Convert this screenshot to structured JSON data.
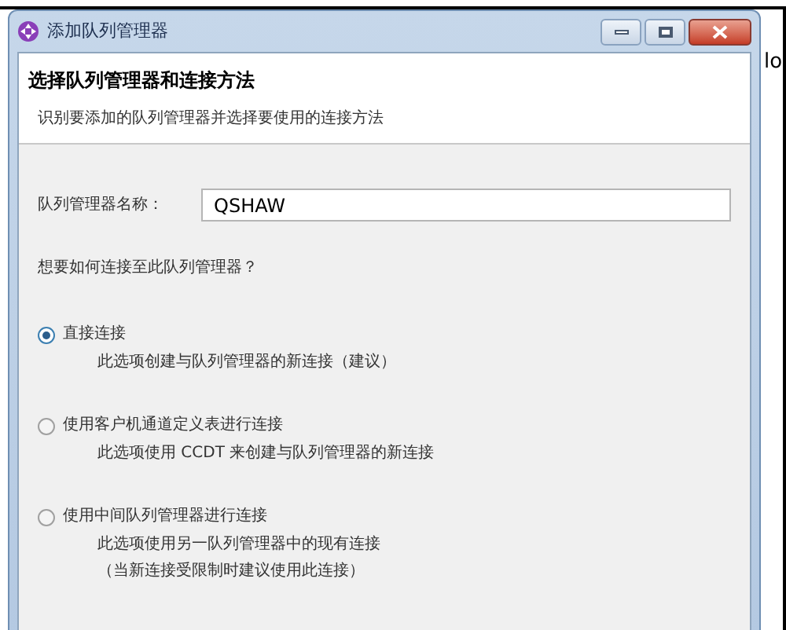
{
  "window": {
    "title": "添加队列管理器"
  },
  "background_text": "lo",
  "header": {
    "title": "选择队列管理器和连接方法",
    "subtitle": "识别要添加的队列管理器并选择要使用的连接方法"
  },
  "name_field": {
    "label": "队列管理器名称：",
    "value": "QSHAW"
  },
  "question": "想要如何连接至此队列管理器？",
  "options": [
    {
      "label": "直接连接",
      "selected": true,
      "description": [
        "此选项创建与队列管理器的新连接（建议）"
      ]
    },
    {
      "label": "使用客户机通道定义表进行连接",
      "selected": false,
      "description": [
        "此选项使用 CCDT 来创建与队列管理器的新连接"
      ]
    },
    {
      "label": "使用中间队列管理器进行连接",
      "selected": false,
      "description": [
        "此选项使用另一队列管理器中的现有连接",
        "（当新连接受限制时建议使用此连接）"
      ]
    }
  ]
}
